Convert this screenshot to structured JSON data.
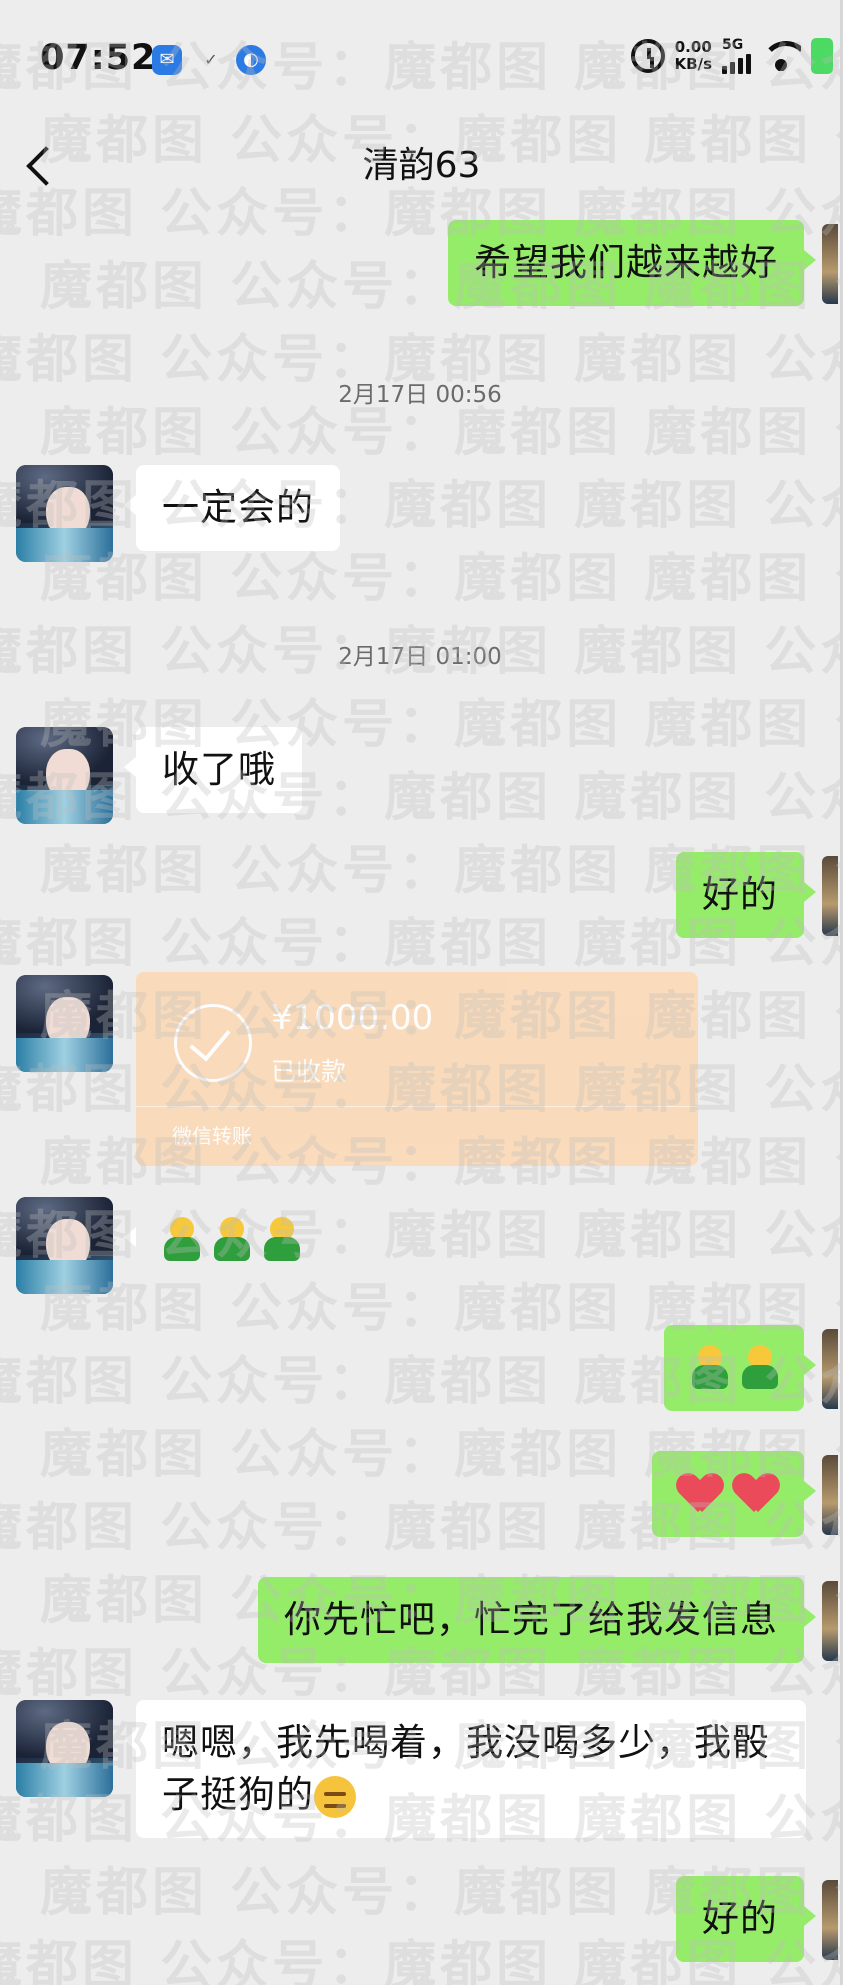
{
  "status_bar": {
    "time": "07:52",
    "net_speed_value": "0.00",
    "net_speed_unit": "KB/s",
    "network_type": "5G"
  },
  "header": {
    "title": "清韵63"
  },
  "messages": {
    "m1": "希望我们越来越好",
    "ts1": "2月17日 00:56",
    "m2": "一定会的",
    "ts2": "2月17日 01:00",
    "m3": "收了哦",
    "m4": "好的",
    "transfer": {
      "amount": "¥1000.00",
      "status": "已收款",
      "footer": "微信转账"
    },
    "m9": "你先忙吧，忙完了给我发信息",
    "m10": "嗯嗯，我先喝着，我没喝多少，我骰子挺狗的",
    "m11": "好的"
  },
  "watermark": "魔都图  公众号：魔都图"
}
